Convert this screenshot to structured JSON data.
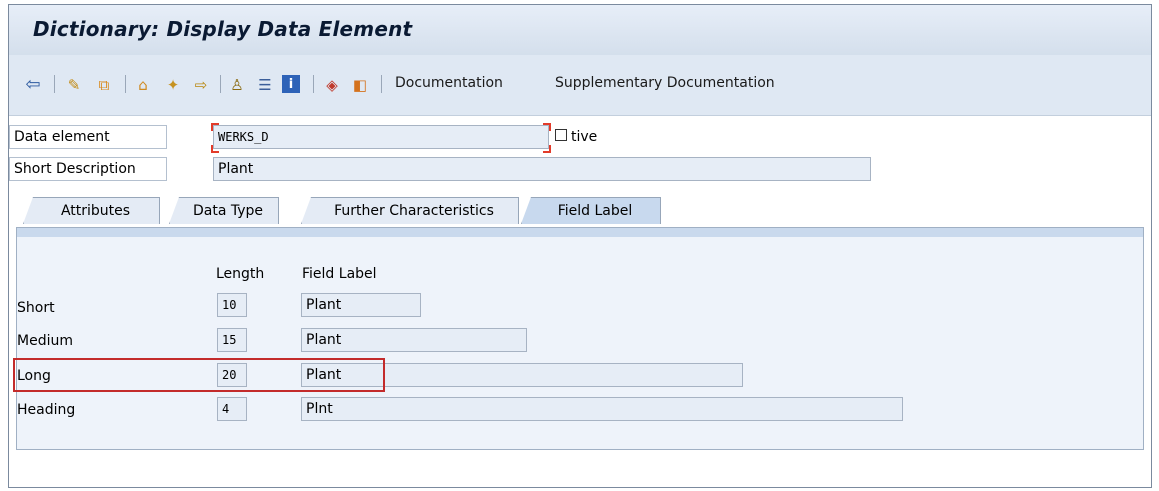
{
  "window": {
    "title": "Dictionary: Display Data Element"
  },
  "toolbar": {
    "icons": [
      "back-icon",
      "display-change-icon",
      "activate-icon",
      "where-used-icon",
      "magic-wand-icon",
      "navigate-icon",
      "hierarchy-icon",
      "list-icon",
      "info-icon",
      "object-list-icon",
      "other-object-icon"
    ],
    "documentation_label": "Documentation",
    "supplementary_label": "Supplementary Documentation"
  },
  "header": {
    "data_element_label": "Data element",
    "data_element_value": "WERKS_D",
    "status_text": "tive",
    "short_desc_label": "Short Description",
    "short_desc_value": "Plant"
  },
  "tabs": [
    {
      "label": "Attributes",
      "active": false
    },
    {
      "label": "Data Type",
      "active": false
    },
    {
      "label": "Further Characteristics",
      "active": false
    },
    {
      "label": "Field Label",
      "active": true
    }
  ],
  "field_labels": {
    "col_length": "Length",
    "col_field_label": "Field Label",
    "rows": [
      {
        "name": "Short",
        "length": "10",
        "label": "Plant"
      },
      {
        "name": "Medium",
        "length": "15",
        "label": "Plant"
      },
      {
        "name": "Long",
        "length": "20",
        "label": "Plant"
      },
      {
        "name": "Heading",
        "length": "4",
        "label": "Plnt"
      }
    ]
  },
  "colors": {
    "highlight": "#c32b2b",
    "required_marker": "#e23b2a",
    "panel_bg": "#eef3fa",
    "toolbar_bg": "#dfe8f3"
  }
}
